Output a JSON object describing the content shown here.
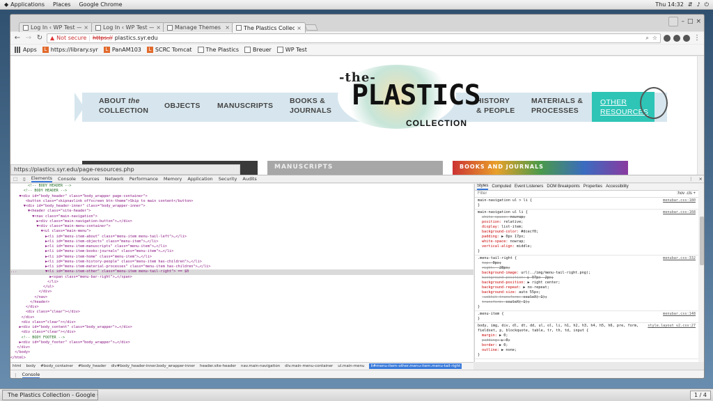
{
  "desktop": {
    "menu_applications": "Applications",
    "menu_places": "Places",
    "menu_chrome": "Google Chrome",
    "clock": "Thu 14:32"
  },
  "tabs": [
    {
      "label": "Log In ‹ WP Test —"
    },
    {
      "label": "Log In ‹ WP Test —"
    },
    {
      "label": "Manage Themes ‹ W"
    },
    {
      "label": "The Plastics Collec"
    }
  ],
  "toolbar": {
    "not_secure": "Not secure",
    "url_scheme": "https://",
    "url_rest": "plastics.syr.edu"
  },
  "bookmarks": [
    {
      "label": "Apps",
      "icon": "apps-grid-icon"
    },
    {
      "label": "https://library.syr",
      "icon": "L"
    },
    {
      "label": "PanAM103",
      "icon": "L"
    },
    {
      "label": "SCRC Tomcat",
      "icon": "L"
    },
    {
      "label": "The Plastics",
      "icon": "doc-icon"
    },
    {
      "label": "Breuer",
      "icon": "doc-icon"
    },
    {
      "label": "WP Test",
      "icon": "doc-icon"
    }
  ],
  "site": {
    "logo_the": "-the-",
    "logo_plastics": "PLASTICS",
    "logo_collection": "COLLECTION",
    "nav_about_1": "ABOUT",
    "nav_about_the": "the",
    "nav_about_2": "COLLECTION",
    "nav_objects": "OBJECTS",
    "nav_manuscripts": "MANUSCRIPTS",
    "nav_books_1": "BOOKS &",
    "nav_books_2": "JOURNALS",
    "nav_history_1": "HISTORY",
    "nav_history_2": "& PEOPLE",
    "nav_materials_1": "MATERIALS &",
    "nav_materials_2": "PROCESSES",
    "nav_other_1": "OTHER",
    "nav_other_2": "RESOURCES",
    "feature_manuscripts": "MANUSCRIPTS",
    "feature_books": "BOOKS AND JOURNALS",
    "status_url": "https://plastics.syr.edu/page-resources.php"
  },
  "devtools": {
    "tabs": [
      "Elements",
      "Console",
      "Sources",
      "Network",
      "Performance",
      "Memory",
      "Application",
      "Security",
      "Audits"
    ],
    "dom_lines": [
      "        <!-- BODY HEADER -->",
      "      <!-- BODY HEADER -->",
      "    ▼<div id=\"body_header\" class=\"body_wrapper page-container\">",
      "       <button class=\"skipnavlink offscreen btn-theme\">Skip to main content</button>",
      "      ▼<div id=\"body_header-inner\" class=\"body_wrapper-inner\">",
      "        ▼<header class=\"site-header\">",
      "          ▼<nav class=\"main-navigation\">",
      "            ▶<div class=\"main-navigation-button\">…</div>",
      "            ▼<div class=\"main-menu-container\">",
      "              ▼<ul class=\"main-menu\">",
      "                ▶<li id=\"menu-item-about\" class=\"menu-item menu-tail-left\">…</li>",
      "                ▶<li id=\"menu-item-objects\" class=\"menu-item\">…</li>",
      "                ▶<li id=\"menu-item-manuscripts\" class=\"menu-item\">…</li>",
      "                ▶<li id=\"menu-item-books-journals\" class=\"menu-item\">…</li>",
      "                ▶<li id=\"menu-item-home\" class=\"menu-item\">…</li>",
      "                ▶<li id=\"menu-item-history-people\" class=\"menu-item has-children\">…</li>",
      "                ▶<li id=\"menu-item-material-processes\" class=\"menu-item has-children\">…</li>",
      "...             ▼<li id=\"menu-item-other\" class=\"menu-item menu-tail-right\"> == $0",
      "                  ▶<span class=\"menu-bar-right\">…</span>",
      "                 </li>",
      "               </ul>",
      "             </div>",
      "           </nav>",
      "         </header>",
      "       </div>",
      "       <div class=\"clear\"></div>",
      "     </div>",
      "     <div class=\"clear\"></div>",
      "    ▶<div id=\"body_content\" class=\"body_wrapper\">…</div>",
      "     <div class=\"clear\"></div>",
      "     <!-- BODY FOOTER -->",
      "    ▶<div id=\"body_footer\" class=\"body_wrapper\">…</div>",
      "   </div>",
      "  </body>",
      "</html>"
    ],
    "selected_line": 17,
    "styles_tabs": [
      "Styles",
      "Computed",
      "Event Listeners",
      "DOM Breakpoints",
      "Properties",
      "Accessibility"
    ],
    "filter": "Filter",
    "hov": ":hov  .cls  +",
    "rules": [
      {
        "selector": "main-navigation ul > li {",
        "src": "menubar.css:180",
        "decls": []
      },
      {
        "selector": "main-navigation ul li {",
        "src": "menubar.css:168",
        "decls": [
          {
            "p": "white-space:",
            "v": "nowrap;",
            "strike": true
          },
          {
            "p": "position:",
            "v": "relative;"
          },
          {
            "p": "display:",
            "v": "list-item;"
          },
          {
            "p": "background-color:",
            "v": "#dcecf0;"
          },
          {
            "p": "padding:",
            "v": "▶ 0px 17px;"
          },
          {
            "p": "white-space:",
            "v": "nowrap;"
          },
          {
            "p": "vertical-align:",
            "v": "middle;"
          }
        ]
      },
      {
        "selector": ".menu-tail-right {",
        "src": "menubar.css:332",
        "decls": [
          {
            "p": "top:",
            "v": "0px;",
            "strike": true
          },
          {
            "p": "right:",
            "v": "-28px;",
            "strike": true
          },
          {
            "p": "background-image:",
            "v": "url(../img/menu-tail-right.png);"
          },
          {
            "p": "background-position:",
            "v": "▶ 97px -2px;",
            "strike": true
          },
          {
            "p": "background-position:",
            "v": "▶ right center;"
          },
          {
            "p": "background-repeat:",
            "v": "▶ no-repeat;"
          },
          {
            "p": "background-size:",
            "v": "auto 55px;"
          },
          {
            "p": "-webkit-transform:",
            "v": "scaleX(-1);",
            "strike": true
          },
          {
            "p": "transform:",
            "v": "scaleX(-1);",
            "strike": true
          }
        ]
      },
      {
        "selector": ".menu-item {",
        "src": "menubar.css:148",
        "decls": []
      },
      {
        "selector": "body, img, div, dl, dt, dd, ul, ol, li, h1, h2, h3, h4, h5, h6, pre, form, fieldset, p, blockquote, table, tr, th, td, input {",
        "src": "style.layout_v2.css:27",
        "decls": [
          {
            "p": "margin:",
            "v": "▶ 0;"
          },
          {
            "p": "padding:",
            "v": "▶ 0;",
            "strike": true
          },
          {
            "p": "border:",
            "v": "▶ 0;"
          },
          {
            "p": "outline:",
            "v": "▶ none;"
          }
        ]
      }
    ],
    "breadcrumb": [
      "html",
      "body",
      "#body_container",
      "#body_header",
      "div#body_header-inner.body_wrapper-inner",
      "header.site-header",
      "nav.main-navigation",
      "div.main-menu-container",
      "ul.main-menu",
      "li#menu-item-other.menu-item.menu-tail-right"
    ],
    "console_label": "Console"
  },
  "taskbar": {
    "item": "The Plastics Collection - Google Chr...",
    "workspace": "1 / 4"
  }
}
